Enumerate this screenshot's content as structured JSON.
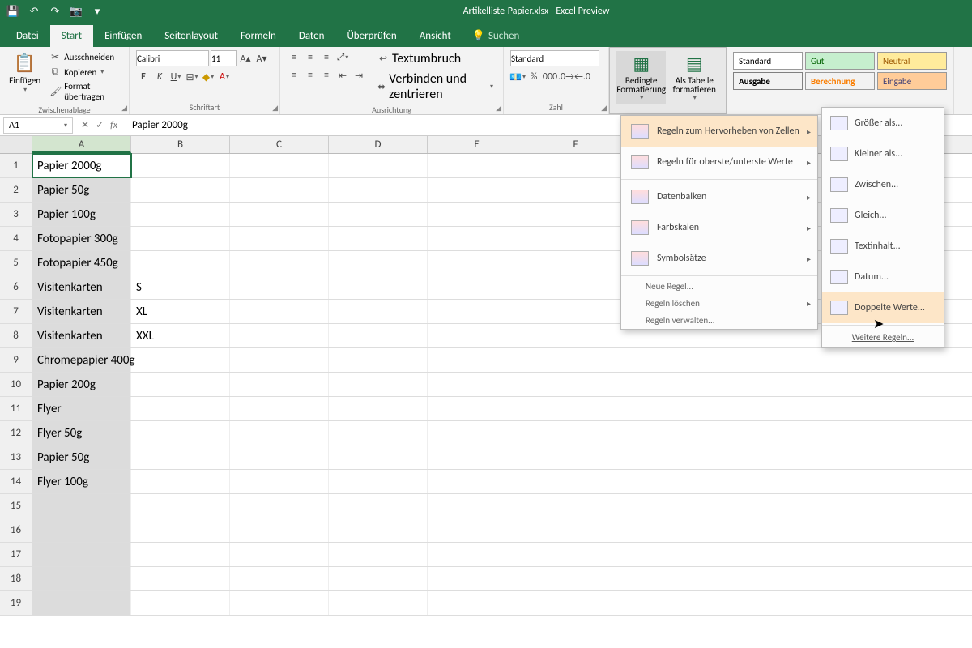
{
  "title": "Artikelliste-Papier.xlsx  -  Excel Preview",
  "tabs": {
    "datei": "Datei",
    "start": "Start",
    "einfugen": "Einfügen",
    "seitenlayout": "Seitenlayout",
    "formeln": "Formeln",
    "daten": "Daten",
    "uberprufen": "Überprüfen",
    "ansicht": "Ansicht"
  },
  "tellme": "Suchen",
  "clipboard": {
    "einfugen": "Einfügen",
    "ausschneiden": "Ausschneiden",
    "kopieren": "Kopieren",
    "format": "Format übertragen",
    "label": "Zwischenablage"
  },
  "font": {
    "name": "Calibri",
    "size": "11",
    "label": "Schriftart"
  },
  "align": {
    "wrap": "Textumbruch",
    "merge": "Verbinden und zentrieren",
    "label": "Ausrichtung"
  },
  "number": {
    "format": "Standard",
    "label": "Zahl"
  },
  "styles": {
    "bedingte": "Bedingte Formatierung",
    "alstabelle": "Als Tabelle formatieren",
    "standard": "Standard",
    "gut": "Gut",
    "neutral": "Neutral",
    "ausgabe": "Ausgabe",
    "berechnung": "Berechnung",
    "eingabe": "Eingabe"
  },
  "namebox": "A1",
  "formula": "Papier 2000g",
  "columns": [
    "A",
    "B",
    "C",
    "D",
    "E",
    "F"
  ],
  "rows": [
    {
      "n": 1,
      "a": "Papier 2000g",
      "b": ""
    },
    {
      "n": 2,
      "a": "Papier 50g",
      "b": ""
    },
    {
      "n": 3,
      "a": "Papier 100g",
      "b": ""
    },
    {
      "n": 4,
      "a": "Fotopapier 300g",
      "b": ""
    },
    {
      "n": 5,
      "a": "Fotopapier 450g",
      "b": ""
    },
    {
      "n": 6,
      "a": "Visitenkarten",
      "b": "S"
    },
    {
      "n": 7,
      "a": "Visitenkarten",
      "b": "XL"
    },
    {
      "n": 8,
      "a": "Visitenkarten",
      "b": "XXL"
    },
    {
      "n": 9,
      "a": "Chromepapier 400g",
      "b": ""
    },
    {
      "n": 10,
      "a": "Papier 200g",
      "b": ""
    },
    {
      "n": 11,
      "a": "Flyer",
      "b": ""
    },
    {
      "n": 12,
      "a": "Flyer 50g",
      "b": ""
    },
    {
      "n": 13,
      "a": "Papier 50g",
      "b": ""
    },
    {
      "n": 14,
      "a": "Flyer 100g",
      "b": ""
    },
    {
      "n": 15,
      "a": "",
      "b": ""
    },
    {
      "n": 16,
      "a": "",
      "b": ""
    },
    {
      "n": 17,
      "a": "",
      "b": ""
    },
    {
      "n": 18,
      "a": "",
      "b": ""
    },
    {
      "n": 19,
      "a": "",
      "b": ""
    }
  ],
  "cf_menu": {
    "hervorheben": "Regeln zum Hervorheben von Zellen",
    "oberste": "Regeln für oberste/unterste Werte",
    "datenbalken": "Datenbalken",
    "farbskalen": "Farbskalen",
    "symbolsatze": "Symbolsätze",
    "neue": "Neue Regel...",
    "loschen": "Regeln löschen",
    "verwalten": "Regeln verwalten..."
  },
  "sub_menu": {
    "grosser": "Größer als...",
    "kleiner": "Kleiner als...",
    "zwischen": "Zwischen...",
    "gleich": "Gleich...",
    "textinhalt": "Textinhalt...",
    "datum": "Datum...",
    "doppelte": "Doppelte Werte...",
    "weitere": "Weitere Regeln..."
  }
}
